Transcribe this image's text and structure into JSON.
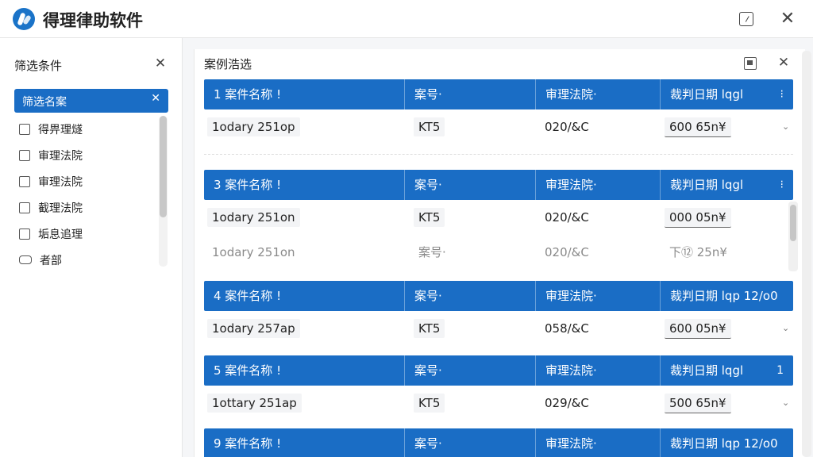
{
  "app": {
    "title": "得理律助软件"
  },
  "filter": {
    "title": "筛选条件",
    "selected_label": "筛选名案",
    "items": [
      {
        "label": "得畀理燧",
        "checked": false
      },
      {
        "label": "审理法院",
        "checked": false
      },
      {
        "label": "审理法院",
        "checked": false
      },
      {
        "label": "截理法院",
        "checked": false
      },
      {
        "label": "垢息追理",
        "checked": false
      },
      {
        "label": "者部",
        "checked": false
      }
    ]
  },
  "panel": {
    "title": "案例浩选",
    "groups": [
      {
        "headers": [
          "1 案件名称 !",
          "案号·",
          "审理法院·",
          "裁判日期 lqgl"
        ],
        "button": "⁝",
        "rows": [
          {
            "name": "1odary 251op",
            "case_no": "KT5",
            "court": "020/&C",
            "date": "600 65n¥",
            "faded": false
          }
        ]
      },
      {
        "headers": [
          "3 案件名称 !",
          "案号·",
          "审理法院·",
          "裁判日期 lqgl"
        ],
        "button": "⁝",
        "rows": [
          {
            "name": "1odary 251on",
            "case_no": "KT5",
            "court": "020/&C",
            "date": "000 05n¥",
            "faded": false
          },
          {
            "name": "1odary 251on",
            "case_no": "案号·",
            "court": "020/&C",
            "date": "下⑫ 25n¥",
            "faded": true
          }
        ]
      },
      {
        "headers": [
          "4 案件名称 !",
          "案号·",
          "审理法院·",
          "裁判日期 lqp 12/o0"
        ],
        "button": "",
        "rows": [
          {
            "name": "1odary 257ap",
            "case_no": "KT5",
            "court": "058/&C",
            "date": "600 05n¥",
            "faded": false
          }
        ]
      },
      {
        "headers": [
          "5 案件名称 !",
          "案号·",
          "审理法院·",
          "裁判日期 lqgl"
        ],
        "button": "1",
        "rows": [
          {
            "name": "1ottary 251ap",
            "case_no": "KT5",
            "court": "029/&C",
            "date": "500 65n¥",
            "faded": false
          }
        ]
      },
      {
        "headers": [
          "9 案件名称 !",
          "案号·",
          "审理法院·",
          "裁判日期 lqp 12/o0"
        ],
        "button": "",
        "rows": []
      }
    ]
  },
  "colors": {
    "accent": "#1a6dc5",
    "panel_bg": "#f5f6f8"
  },
  "icons": [
    "app-logo-icon",
    "restore-icon",
    "close-icon",
    "chevron-down-icon"
  ]
}
